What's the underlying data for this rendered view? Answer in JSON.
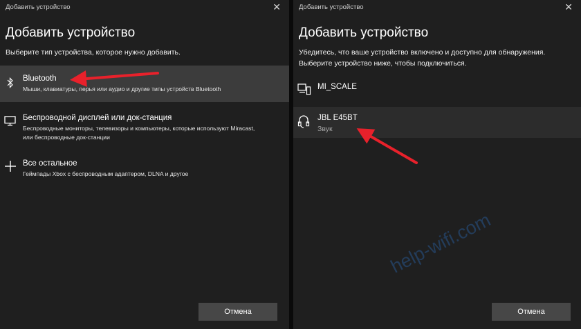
{
  "left": {
    "window_title": "Добавить устройство",
    "close_glyph": "✕",
    "heading": "Добавить устройство",
    "subtitle": "Выберите тип устройства, которое нужно добавить.",
    "items": [
      {
        "title": "Bluetooth",
        "desc": "Мыши, клавиатуры, перья или аудио и другие типы устройств Bluetooth",
        "icon": "bluetooth-icon"
      },
      {
        "title": "Беспроводной дисплей или док-станция",
        "desc": "Беспроводные мониторы, телевизоры и компьютеры, которые используют Miracast, или беспроводные док-станции",
        "icon": "monitor-icon"
      },
      {
        "title": "Все остальное",
        "desc": "Геймпады Xbox с беспроводным адаптером, DLNA и другое",
        "icon": "plus-icon"
      }
    ],
    "cancel_label": "Отмена"
  },
  "right": {
    "window_title": "Добавить устройство",
    "close_glyph": "✕",
    "heading": "Добавить устройство",
    "subtitle_line1": "Убедитесь, что ваше устройство включено и доступно для обнаружения.",
    "subtitle_line2": "Выберите устройство ниже, чтобы подключиться.",
    "devices": [
      {
        "name": "MI_SCALE",
        "subtitle": "",
        "icon": "device-icon"
      },
      {
        "name": "JBL E45BT",
        "subtitle": "Звук",
        "icon": "headphones-icon"
      }
    ],
    "cancel_label": "Отмена"
  },
  "watermark": "help-wifi.com",
  "colors": {
    "background": "#1f1f1f",
    "selected": "#3c3c3c",
    "button": "#474747",
    "arrow": "#e8212b"
  }
}
